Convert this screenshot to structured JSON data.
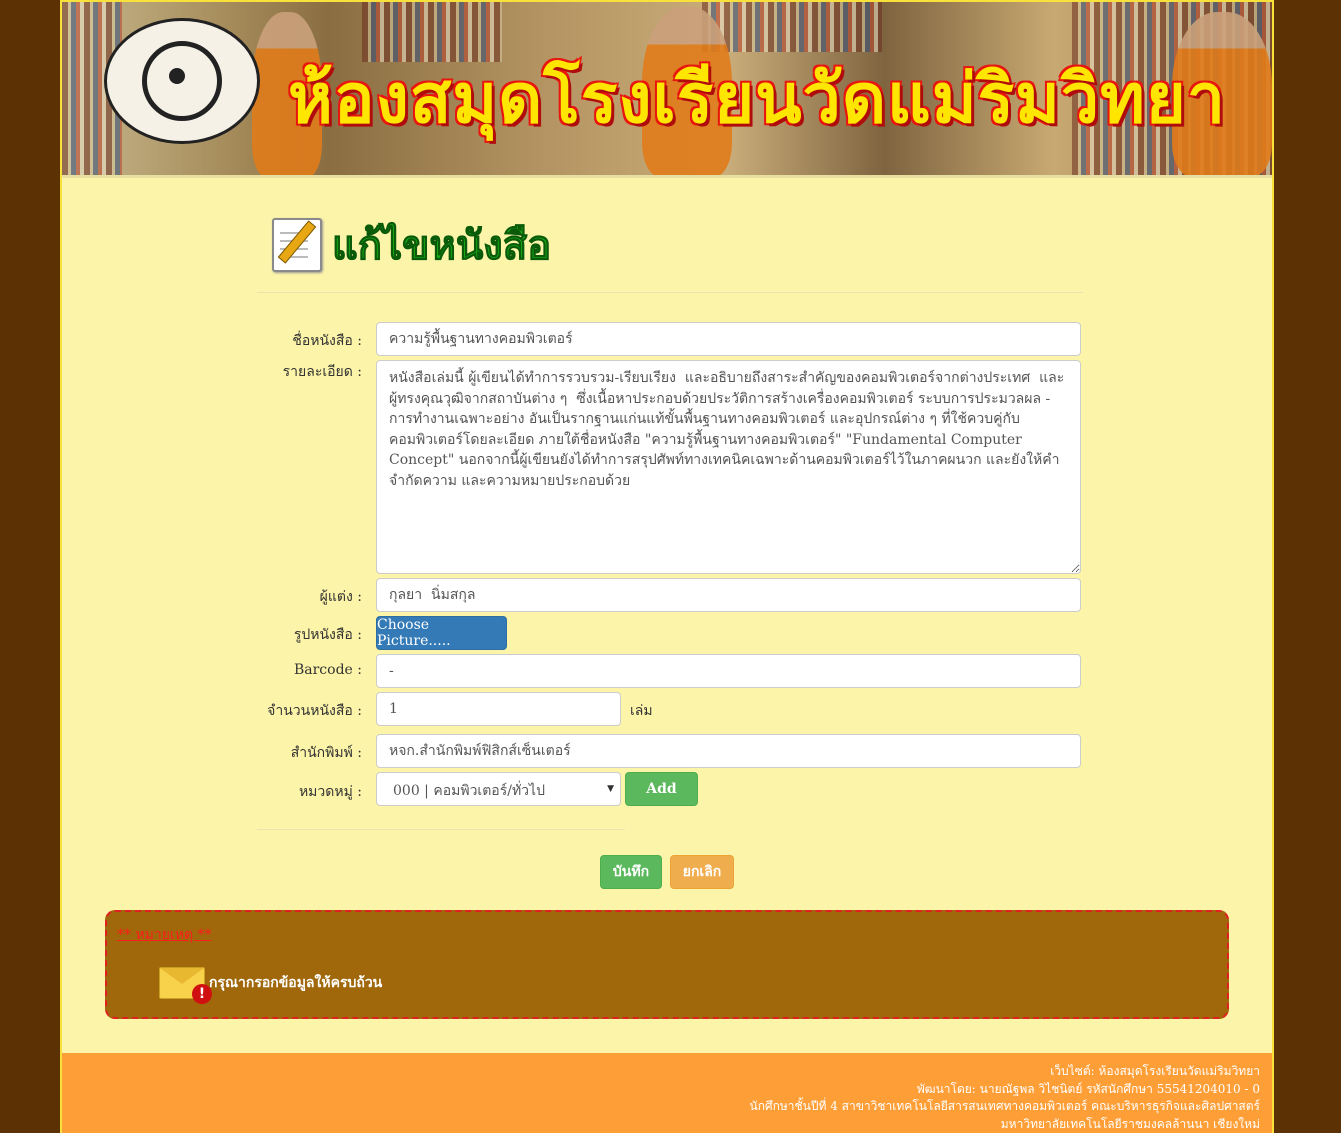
{
  "banner": {
    "title": "ห้องสมุดโรงเรียนวัดแม่ริมวิทยา"
  },
  "heading": {
    "title": "แก้ไขหนังสือ"
  },
  "form": {
    "book_name": {
      "label": "ชื่อหนังสือ :",
      "value": "ความรู้พื้นฐานทางคอมพิวเตอร์"
    },
    "detail": {
      "label": "รายละเอียด :",
      "value": "หนังสือเล่มนี้ ผู้เขียนได้ทำการรวบรวม-เรียบเรียง  และอธิบายถึงสาระสำคัญของคอมพิวเตอร์จากต่างประเทศ  และผู้ทรงคุณวุฒิจากสถาบันต่าง ๆ  ซึ่งเนื้อหาประกอบด้วยประวัติการสร้างเครื่องคอมพิวเตอร์ ระบบการประมวลผล - การทำงานเฉพาะอย่าง อันเป็นรากฐานแก่นแท้ขั้นพื้นฐานทางคอมพิวเตอร์ และอุปกรณ์ต่าง ๆ ที่ใช้ควบคู่กับคอมพิวเตอร์โดยละเอียด ภายใต้ชื่อหนังสือ \"ความรู้พื้นฐานทางคอมพิวเตอร์\" \"Fundamental Computer Concept\" นอกจากนี้ผู้เขียนยังได้ทำการสรุปศัพท์ทางเทคนิคเฉพาะด้านคอมพิวเตอร์ไว้ในภาคผนวก และยังให้คำจำกัดความ และความหมายประกอบด้วย"
    },
    "author": {
      "label": "ผู้แต่ง :",
      "value": "กุลยา  นิ่มสกุล"
    },
    "picture": {
      "label": "รูปหนังสือ :",
      "button": "Choose Picture....."
    },
    "barcode": {
      "label": "Barcode :",
      "value": "-"
    },
    "quantity": {
      "label": "จำนวนหนังสือ :",
      "value": "1",
      "unit": "เล่ม"
    },
    "publisher": {
      "label": "สำนักพิมพ์ :",
      "value": "หจก.สำนักพิมพ์ฟิสิกส์เซ็นเตอร์"
    },
    "category": {
      "label": "หมวดหมู่ :",
      "selected": "000 | คอมพิวเตอร์/ทั่วไป",
      "add_button": "Add"
    }
  },
  "actions": {
    "save": "บันทึก",
    "cancel": "ยกเลิก"
  },
  "note": {
    "title": "** หมายเหตุ **",
    "message": "กรุณากรอกข้อมูลให้ครบถ้วน",
    "icon": "envelope-alert-icon"
  },
  "footer": {
    "lines": [
      "เว็บไซต์: ห้องสมุดโรงเรียนวัดแม่ริมวิทยา",
      "พัฒนาโดย: นายณัฐพล วิไชนิตย์ รหัสนักศึกษา 55541204010 - 0",
      "นักศึกษาชั้นปีที่ 4 สาขาวิชาเทคโนโลยีสารสนเทศทางคอมพิวเตอร์ คณะบริหารธุรกิจและศิลปศาสตร์",
      "มหาวิทยาลัยเทคโนโลยีราชมงคลล้านนา เชียงใหม่"
    ]
  },
  "colors": {
    "background": "#5c3104",
    "panel": "#fcf4a8",
    "heading": "#18b018",
    "footer": "#fe9e36",
    "note_box": "#a0680a",
    "note_border": "#e02020"
  }
}
